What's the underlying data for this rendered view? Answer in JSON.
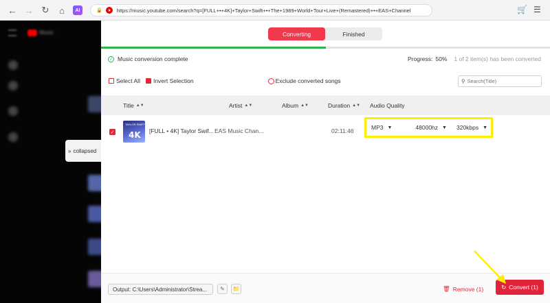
{
  "browser": {
    "url": "https://music.youtube.com/search?q=[FULL+•+4K]+Taylor+Swift+•+The+1989+World+Tour+Live+(Remastered)+•+EAS+Channel",
    "ai_badge": "AI"
  },
  "sidebar": {
    "logo_text": "Music",
    "collapsed_label": "collapsed"
  },
  "tabs": [
    {
      "label": "Converting",
      "active": true
    },
    {
      "label": "Finished",
      "active": false
    }
  ],
  "status": {
    "message": "Music conversion complete",
    "progress_label": "Progress:",
    "progress_percent": "50%",
    "progress_value": 0.5,
    "progress_detail": "1 of 2 item(s) has been converted"
  },
  "toolbar": {
    "select_all": "Select All",
    "invert_selection": "Invert Selection",
    "exclude_converted": "Exclude converted songs",
    "search_placeholder": "Search(Title)"
  },
  "table": {
    "columns": [
      "Title",
      "Artist",
      "Album",
      "Duration",
      "Audio Quality"
    ],
    "rows": [
      {
        "title": "[FULL • 4K] Taylor Swif...",
        "artist": "EAS Music Chan...",
        "album": "",
        "duration": "02:11:46",
        "format": "MP3",
        "sample_rate": "48000hz",
        "bitrate": "320kbps",
        "thumb_text": "4K",
        "thumb_subtext": "TAYLOR SWIFT"
      }
    ]
  },
  "footer": {
    "output_label": "Output: C:\\Users\\Administrator\\Strea...",
    "remove_label": "Remove (1)",
    "convert_label": "Convert (1)"
  },
  "colors": {
    "accent": "#e0233a",
    "progress": "#2fb44a",
    "highlight": "#ffee00"
  }
}
